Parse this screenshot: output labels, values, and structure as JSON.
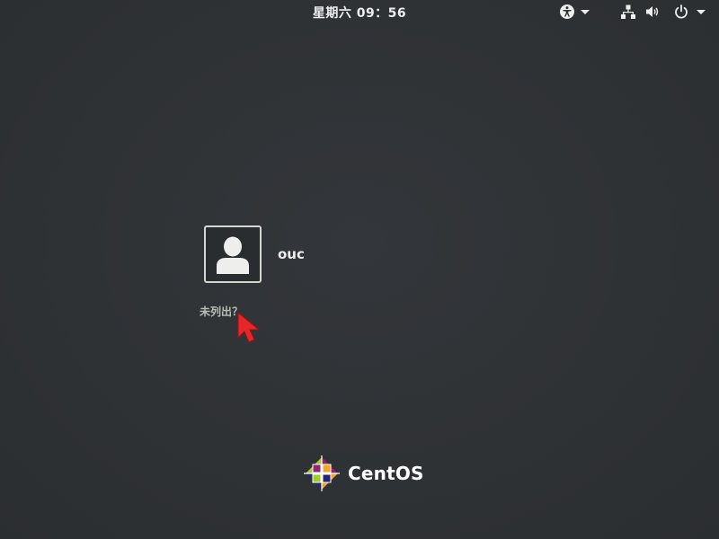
{
  "topbar": {
    "clock": "星期六  09：56",
    "accessibility_icon": "accessibility-icon",
    "network_icon": "network-wired-icon",
    "volume_icon": "volume-icon",
    "power_icon": "power-icon",
    "menu_caret_icon": "chevron-down-icon"
  },
  "login": {
    "user": {
      "name": "ouc",
      "avatar_icon": "user-avatar-icon"
    },
    "not_listed_label": "未列出？"
  },
  "branding": {
    "logo_icon": "centos-logo-icon",
    "logo_text": "CentOS"
  },
  "colors": {
    "background": "#2e3133",
    "text": "#eeeeec",
    "muted_text": "#babdb6",
    "cursor": "#e8262a"
  }
}
